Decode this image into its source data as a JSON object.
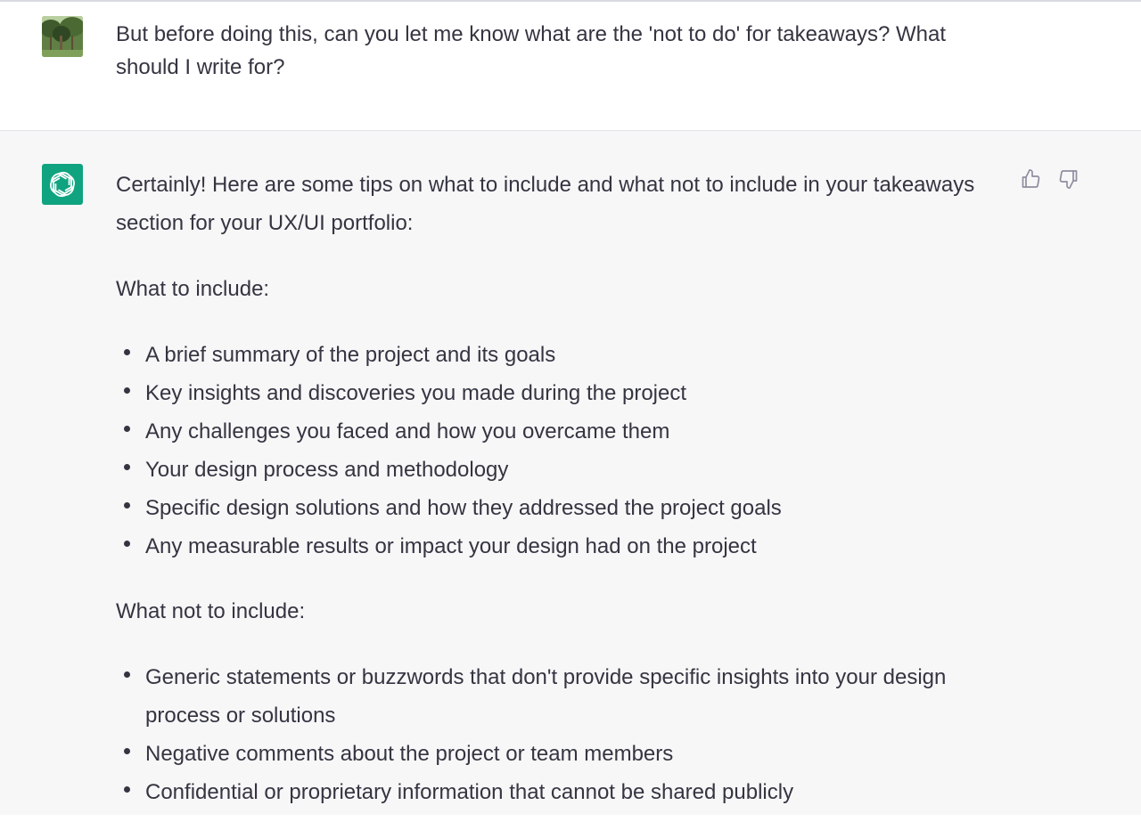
{
  "user_message": {
    "text": "But before doing this, can you let me know what are the 'not to do' for takeaways? What should I write for?",
    "avatar_icon": "user-photo-avatar"
  },
  "assistant_message": {
    "avatar_icon": "openai-logo-icon",
    "accent_color": "#10a37f",
    "intro": "Certainly! Here are some tips on what to include and what not to include in your takeaways section for your UX/UI portfolio:",
    "include_heading": "What to include:",
    "include_items": [
      "A brief summary of the project and its goals",
      "Key insights and discoveries you made during the project",
      "Any challenges you faced and how you overcame them",
      "Your design process and methodology",
      "Specific design solutions and how they addressed the project goals",
      "Any measurable results or impact your design had on the project"
    ],
    "exclude_heading": "What not to include:",
    "exclude_items": [
      "Generic statements or buzzwords that don't provide specific insights into your design process or solutions",
      "Negative comments about the project or team members",
      "Confidential or proprietary information that cannot be shared publicly"
    ]
  },
  "feedback": {
    "thumbs_up_icon": "thumbs-up-icon",
    "thumbs_down_icon": "thumbs-down-icon"
  }
}
